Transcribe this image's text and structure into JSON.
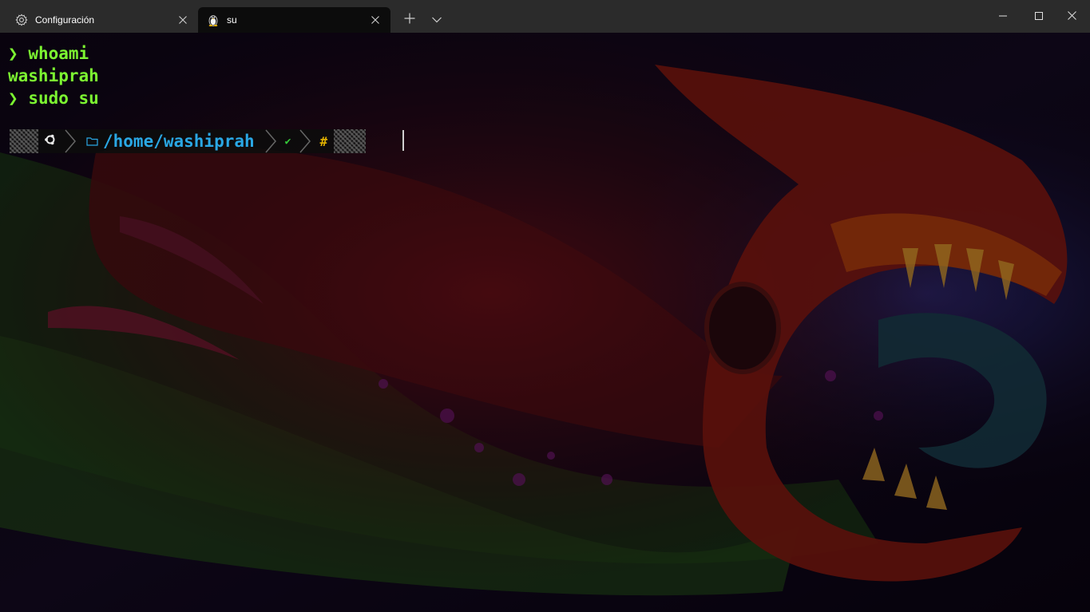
{
  "window": {
    "tabs": [
      {
        "label": "Configuración",
        "icon": "gear-icon",
        "active": false
      },
      {
        "label": "su",
        "icon": "linux-penguin-icon",
        "active": true
      }
    ],
    "new_tab_icon": "plus-icon",
    "dropdown_icon": "chevron-down-icon",
    "controls": [
      "minimize-icon",
      "maximize-icon",
      "close-icon"
    ]
  },
  "terminal": {
    "lines": [
      {
        "prompt": "❯",
        "text": "whoami"
      },
      {
        "prompt": "",
        "text": "washiprah"
      },
      {
        "prompt": "❯",
        "text": "sudo su"
      }
    ],
    "prompt": {
      "os_icon": "ubuntu-icon",
      "folder_icon": "folder-icon",
      "path": "/home/washiprah",
      "status": "✔",
      "symbol": "#"
    }
  },
  "colors": {
    "titlebar": "#2b2b2b",
    "active_tab": "#0c0c0c",
    "text_green": "#7cf531",
    "path_blue": "#2aa7e4",
    "hash_yellow": "#e0b000",
    "check_green": "#35c93a"
  }
}
